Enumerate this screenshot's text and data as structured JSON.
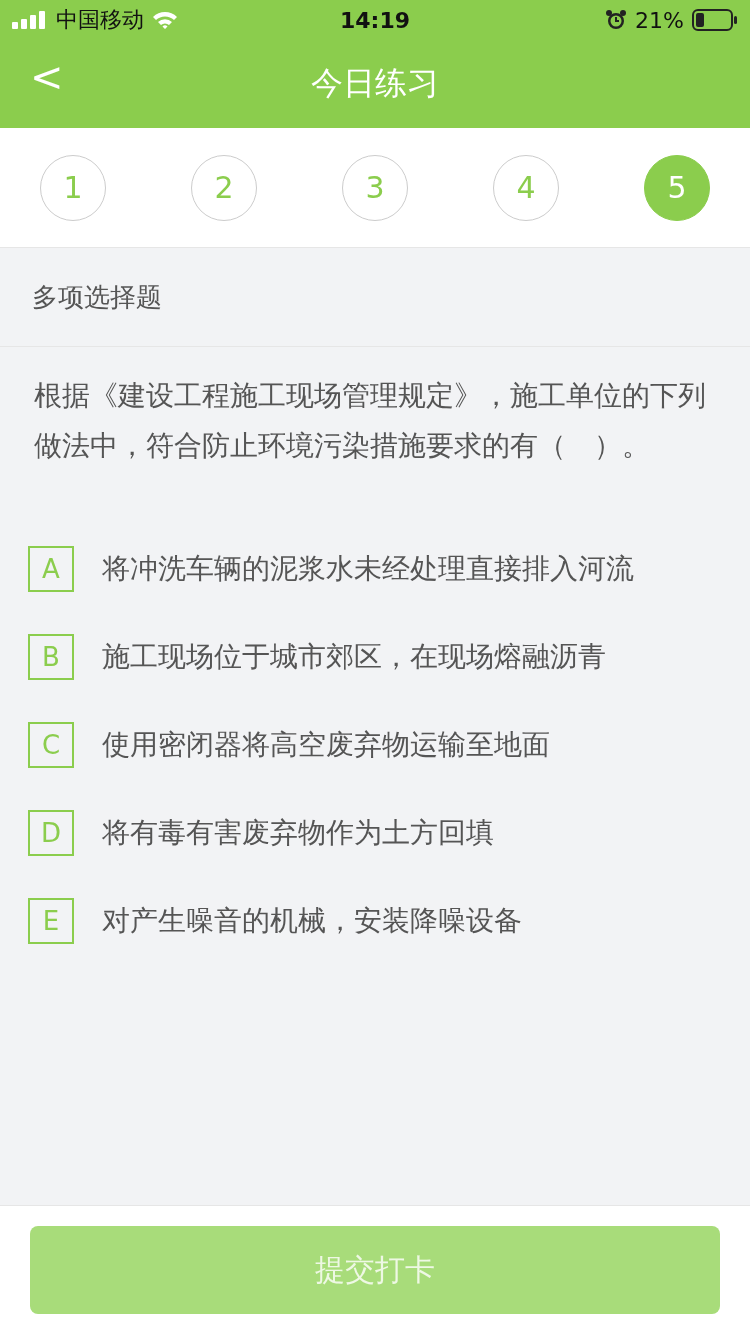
{
  "status_bar": {
    "carrier": "中国移动",
    "time": "14:19",
    "battery_percent": "21%"
  },
  "nav": {
    "back": "<",
    "title": "今日练习"
  },
  "steps": [
    {
      "label": "1",
      "selected": false
    },
    {
      "label": "2",
      "selected": false
    },
    {
      "label": "3",
      "selected": false
    },
    {
      "label": "4",
      "selected": false
    },
    {
      "label": "5",
      "selected": true
    }
  ],
  "question_type": "多项选择题",
  "question": "根据《建设工程施工现场管理规定》，施工单位的下列做法中，符合防止环境污染措施要求的有（　）。",
  "options": [
    {
      "letter": "A",
      "text": "将冲洗车辆的泥浆水未经处理直接排入河流",
      "selected": false
    },
    {
      "letter": "B",
      "text": "施工现场位于城市郊区，在现场熔融沥青",
      "selected": false
    },
    {
      "letter": "C",
      "text": "使用密闭器将高空废弃物运输至地面",
      "selected": false
    },
    {
      "letter": "D",
      "text": "将有毒有害废弃物作为土方回填",
      "selected": false
    },
    {
      "letter": "E",
      "text": "对产生噪音的机械，安装降噪设备",
      "selected": false
    }
  ],
  "submit": {
    "label": "提交打卡",
    "disabled": true
  }
}
